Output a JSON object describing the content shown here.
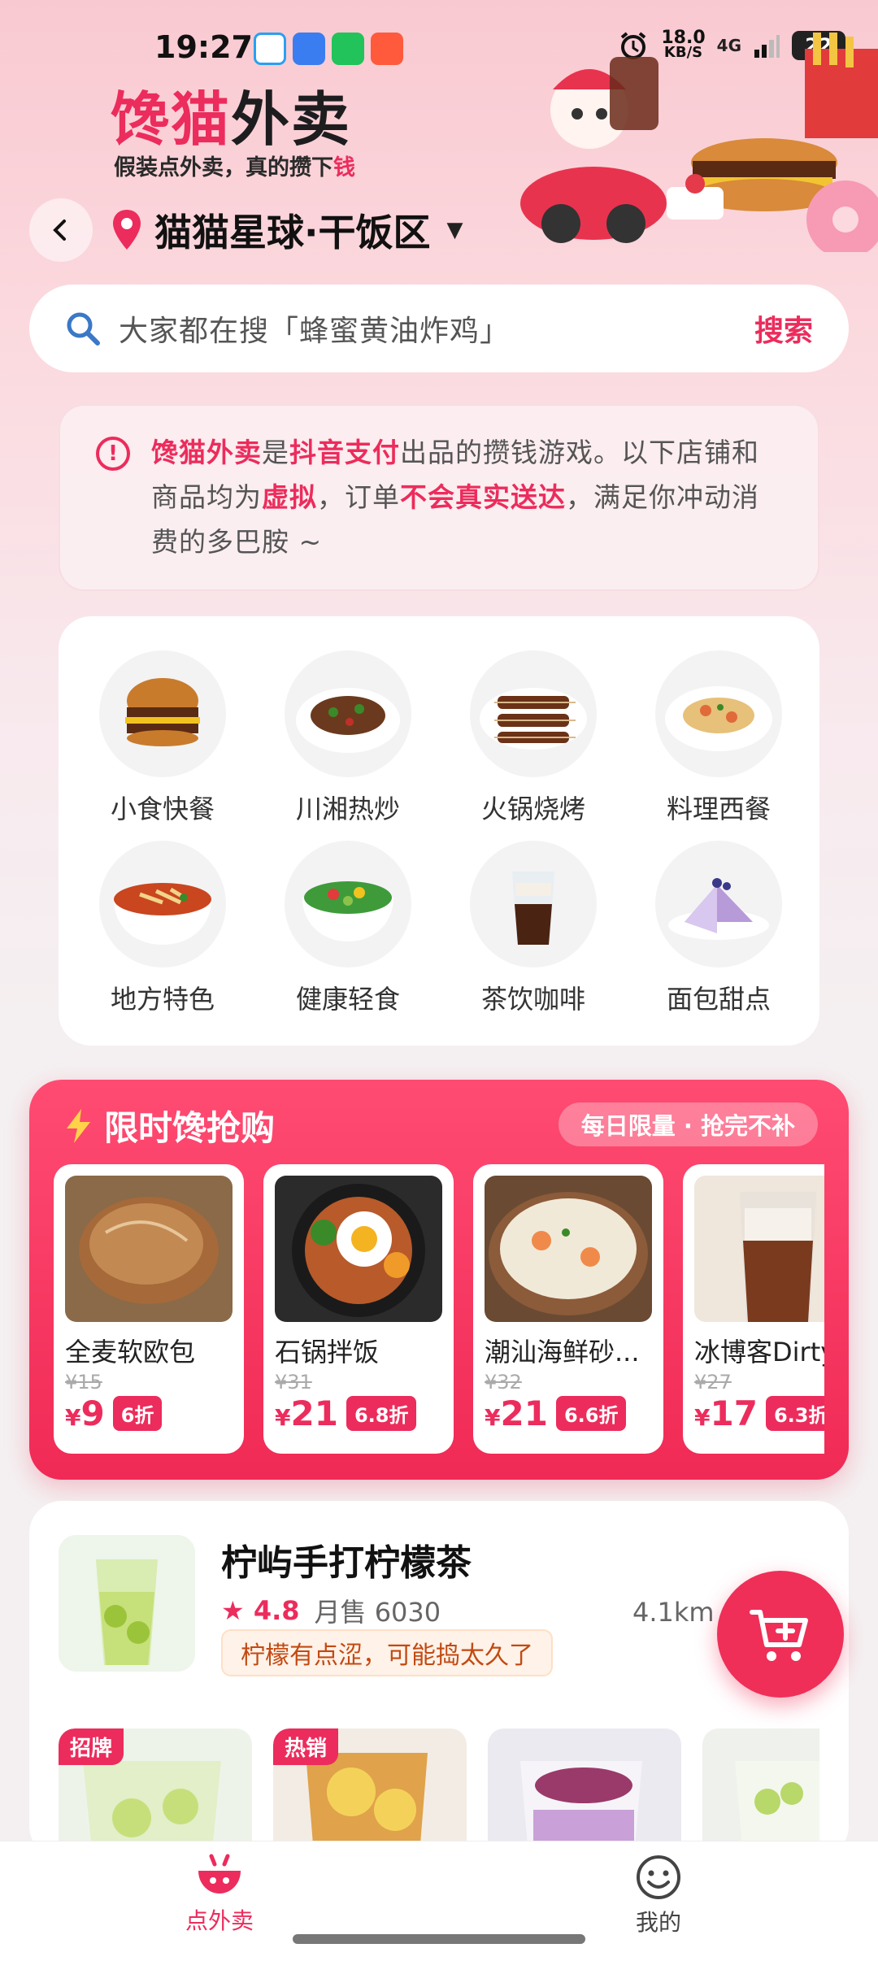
{
  "status_bar": {
    "time": "19:27",
    "net_speed_value": "18.0",
    "net_speed_unit": "KB/S",
    "network": "4G",
    "battery": "22"
  },
  "header": {
    "brand_part1": "馋猫",
    "brand_part2": "外卖",
    "slogan_main": "假装点外卖，真的攒下",
    "slogan_highlight": "钱",
    "location": "猫猫星球·干饭区"
  },
  "search": {
    "placeholder": "大家都在搜「蜂蜜黄油炸鸡」",
    "button": "搜索"
  },
  "notice": {
    "t1": "馋猫外卖",
    "t2": "是",
    "t3": "抖音支付",
    "t4": "出品的攒钱游戏。以下店铺和商品均为",
    "t5": "虚拟",
    "t6": "，订单",
    "t7": "不会真实送达",
    "t8": "，满足你冲动消费的多巴胺 ~"
  },
  "categories": [
    {
      "label": "小食快餐",
      "icon": "burger-icon"
    },
    {
      "label": "川湘热炒",
      "icon": "stir-fry-icon"
    },
    {
      "label": "火锅烧烤",
      "icon": "skewer-icon"
    },
    {
      "label": "料理西餐",
      "icon": "pasta-icon"
    },
    {
      "label": "地方特色",
      "icon": "noodle-bowl-icon"
    },
    {
      "label": "健康轻食",
      "icon": "salad-icon"
    },
    {
      "label": "茶饮咖啡",
      "icon": "coffee-icon"
    },
    {
      "label": "面包甜点",
      "icon": "cake-icon"
    }
  ],
  "flash_sale": {
    "title": "限时馋抢购",
    "tag": "每日限量 · 抢完不补",
    "items": [
      {
        "name": "全麦软欧包",
        "old": "¥15",
        "currency": "¥",
        "price": "9",
        "discount": "6折"
      },
      {
        "name": "石锅拌饭",
        "old": "¥31",
        "currency": "¥",
        "price": "21",
        "discount": "6.8折"
      },
      {
        "name": "潮汕海鲜砂...",
        "old": "¥32",
        "currency": "¥",
        "price": "21",
        "discount": "6.6折"
      },
      {
        "name": "冰博客Dirty",
        "old": "¥27",
        "currency": "¥",
        "price": "17",
        "discount": "6.3折"
      }
    ]
  },
  "shop": {
    "name": "柠屿手打柠檬茶",
    "rating": "★ 4.8",
    "sales": "月售 6030",
    "distance": "4.1km · 49 分",
    "note": "柠檬有点涩，可能捣太久了",
    "product_tags": [
      "招牌",
      "热销"
    ]
  },
  "bottom_nav": {
    "home": "点外卖",
    "me": "我的"
  },
  "colors": {
    "accent": "#ec2c5c",
    "flash_bg": "#f02a55"
  }
}
